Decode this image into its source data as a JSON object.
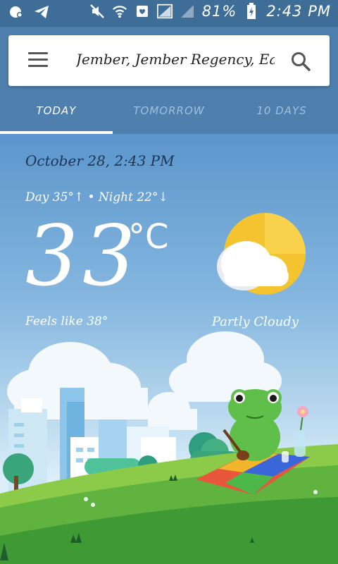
{
  "status_bar": {
    "battery": "81%",
    "time": "2:43 PM",
    "icons": [
      "notification-icon",
      "telegram-icon",
      "mute-icon",
      "wifi-icon",
      "mail-icon",
      "signal-icon",
      "battery-icon"
    ]
  },
  "search": {
    "location": "Jember, Jember Regency, East Java"
  },
  "tabs": [
    {
      "label": "TODAY",
      "active": true
    },
    {
      "label": "TOMORROW",
      "active": false
    },
    {
      "label": "10 DAYS",
      "active": false
    }
  ],
  "weather": {
    "datetime": "October 28, 2:43 PM",
    "day_night": "Day 35°↑ • Night 22°↓",
    "temperature": "33",
    "unit": "°C",
    "feels_like": "Feels like 38°",
    "condition": "Partly Cloudy",
    "icon": "partly-cloudy-icon"
  },
  "colors": {
    "status_bar": "#3e6d98",
    "header": "#4f80ad",
    "sun": "#f4c430",
    "grass": "#4fa33c"
  }
}
